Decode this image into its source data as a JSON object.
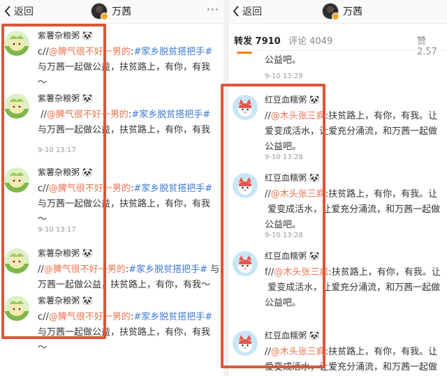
{
  "nav": {
    "back_label": "返回",
    "title": "万茜",
    "more_label": "···"
  },
  "tabs": {
    "repost": "转发 7910",
    "comment": "评论 4049",
    "like": "赞 2.57"
  },
  "left_items": [
    {
      "name": "紫薯杂粮粥",
      "panda": "🐼",
      "lines": [
        {
          "prefix": "c//",
          "mention": "@脾气很不好一男的",
          "sep": ":",
          "topic": "#家乡脱贫搭把手#",
          "suffix": ""
        },
        {
          "prefix": "与万茜一起做公益，扶贫路上，有你，有我",
          "mention": "",
          "sep": "",
          "topic": "",
          "suffix": ""
        },
        {
          "prefix": "～",
          "mention": "",
          "sep": "",
          "topic": "",
          "suffix": ""
        }
      ],
      "time": ""
    },
    {
      "name": "紫薯杂粮粥",
      "panda": "🐼",
      "lines": [
        {
          "prefix": "//",
          "mention": "@脾气很不好一男的",
          "sep": ":",
          "topic": "#家乡脱贫搭把手#",
          "suffix": ""
        },
        {
          "prefix": "与万茜一起做公益，扶贫路上，有你，有我",
          "mention": "",
          "sep": "",
          "topic": "",
          "suffix": ""
        }
      ],
      "time": "9-10 13:17"
    },
    {
      "name": "紫薯杂粮粥",
      "panda": "🐼",
      "lines": [
        {
          "prefix": "c//",
          "mention": "@脾气很不好一男的",
          "sep": ":",
          "topic": "#家乡脱贫搭把手#",
          "suffix": ""
        },
        {
          "prefix": "与万茜一起做公益，扶贫路上，有你，有我",
          "mention": "",
          "sep": "",
          "topic": "",
          "suffix": ""
        },
        {
          "prefix": "～",
          "mention": "",
          "sep": "",
          "topic": "",
          "suffix": ""
        }
      ],
      "time": "9-10 13:17"
    },
    {
      "name": "紫薯杂粮粥",
      "panda": "🐼",
      "lines": [
        {
          "prefix": "//",
          "mention": "@脾气很不好一男的",
          "sep": ":",
          "topic": "#家乡脱贫搭把手#",
          "suffix": " 与"
        },
        {
          "prefix": "万茜一起做公益，扶贫路上，有你，有我～",
          "mention": "",
          "sep": "",
          "topic": "",
          "suffix": ""
        }
      ],
      "time": ""
    },
    {
      "name": "紫薯杂粮粥",
      "panda": "🐼",
      "lines": [
        {
          "prefix": "c//",
          "mention": "@脾气很不好一男的",
          "sep": ":",
          "topic": "#家乡脱贫搭把手#",
          "suffix": ""
        },
        {
          "prefix": "与万茜一起做公益，扶贫路上，有你，有我",
          "mention": "",
          "sep": "",
          "topic": "",
          "suffix": ""
        },
        {
          "prefix": "～",
          "mention": "",
          "sep": "",
          "topic": "",
          "suffix": ""
        }
      ],
      "time": ""
    }
  ],
  "right_top": {
    "text": "公益吧。",
    "time": "9-10 13:28"
  },
  "right_items": [
    {
      "name": "红豆血糯粥",
      "panda": "🐼",
      "lines": [
        {
          "prefix": "//",
          "mention": "@木头张三疯",
          "sep": ":",
          "topic": "",
          "suffix": "扶贫路上，有你，有我。让"
        },
        {
          "prefix": "爱变成活水，让爱充分涌流，和万茜一起做",
          "mention": "",
          "sep": "",
          "topic": "",
          "suffix": ""
        },
        {
          "prefix": "公益吧。",
          "mention": "",
          "sep": "",
          "topic": "",
          "suffix": ""
        }
      ],
      "time": "9-10 13:28"
    },
    {
      "name": "红豆血糯粥",
      "panda": "🐼",
      "lines": [
        {
          "prefix": "//",
          "mention": "@木头张三疯",
          "sep": ":",
          "topic": "",
          "suffix": "扶贫路上，有你，有我。让"
        },
        {
          "prefix": "爱变成活水，让爱充分涌流，和万茜一起做",
          "mention": "",
          "sep": "",
          "topic": "",
          "suffix": ""
        },
        {
          "prefix": "公益吧。",
          "mention": "",
          "sep": "",
          "topic": "",
          "suffix": ""
        }
      ],
      "time": "9-10 13:28"
    },
    {
      "name": "红豆血糯粥",
      "panda": "🐼",
      "lines": [
        {
          "prefix": "f//",
          "mention": "@木头张三疯",
          "sep": ":",
          "topic": "",
          "suffix": "扶贫路上，有你，有我。让"
        },
        {
          "prefix": "爱变成活水，让爱充分涌流，和万茜一起做",
          "mention": "",
          "sep": "",
          "topic": "",
          "suffix": ""
        },
        {
          "prefix": "公益吧。",
          "mention": "",
          "sep": "",
          "topic": "",
          "suffix": ""
        }
      ],
      "time": ""
    },
    {
      "name": "红豆血糯粥",
      "panda": "🐼",
      "lines": [
        {
          "prefix": "//",
          "mention": "@木头张三疯",
          "sep": ":",
          "topic": "",
          "suffix": "扶贫路上，有你，有我。让"
        },
        {
          "prefix": "爱变成活水，让爱充分涌流，和万茜一起做",
          "mention": "",
          "sep": "",
          "topic": "",
          "suffix": ""
        }
      ],
      "time": ""
    }
  ],
  "colors": {
    "highlight": "#d9573a",
    "mention": "#eb7350",
    "topic": "#3b78d3",
    "tab_active": "#f08200"
  }
}
